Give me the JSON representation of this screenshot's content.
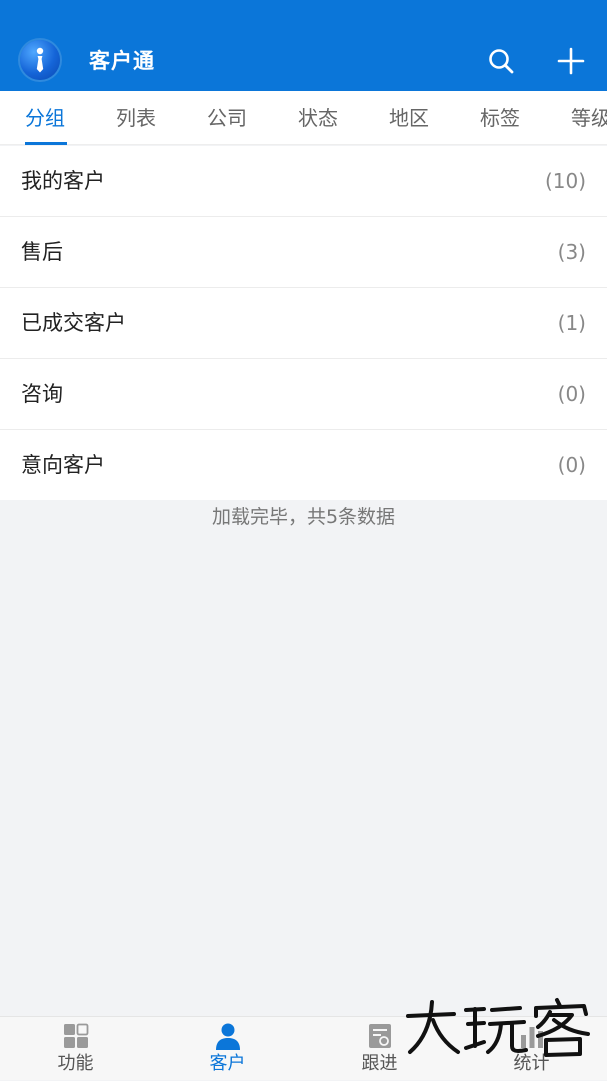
{
  "app": {
    "title": "客户通",
    "logo_icon": "tie-icon",
    "accent_color": "#0b76d9"
  },
  "tabs": [
    {
      "label": "分组",
      "active": true
    },
    {
      "label": "列表",
      "active": false
    },
    {
      "label": "公司",
      "active": false
    },
    {
      "label": "状态",
      "active": false
    },
    {
      "label": "地区",
      "active": false
    },
    {
      "label": "标签",
      "active": false
    },
    {
      "label": "等级",
      "active": false
    }
  ],
  "groups": [
    {
      "name": "我的客户",
      "count": "(10)"
    },
    {
      "name": "售后",
      "count": "(3)"
    },
    {
      "name": "已成交客户",
      "count": "(1)"
    },
    {
      "name": "咨询",
      "count": "(0)"
    },
    {
      "name": "意向客户",
      "count": "(0)"
    }
  ],
  "footer_message": "加载完毕，共5条数据",
  "bottom_nav": [
    {
      "label": "功能",
      "icon": "grid-icon",
      "active": false
    },
    {
      "label": "客户",
      "icon": "person-icon",
      "active": true
    },
    {
      "label": "跟进",
      "icon": "document-icon",
      "active": false
    },
    {
      "label": "统计",
      "icon": "chart-icon",
      "active": false
    }
  ],
  "watermark_text": "大玩客"
}
